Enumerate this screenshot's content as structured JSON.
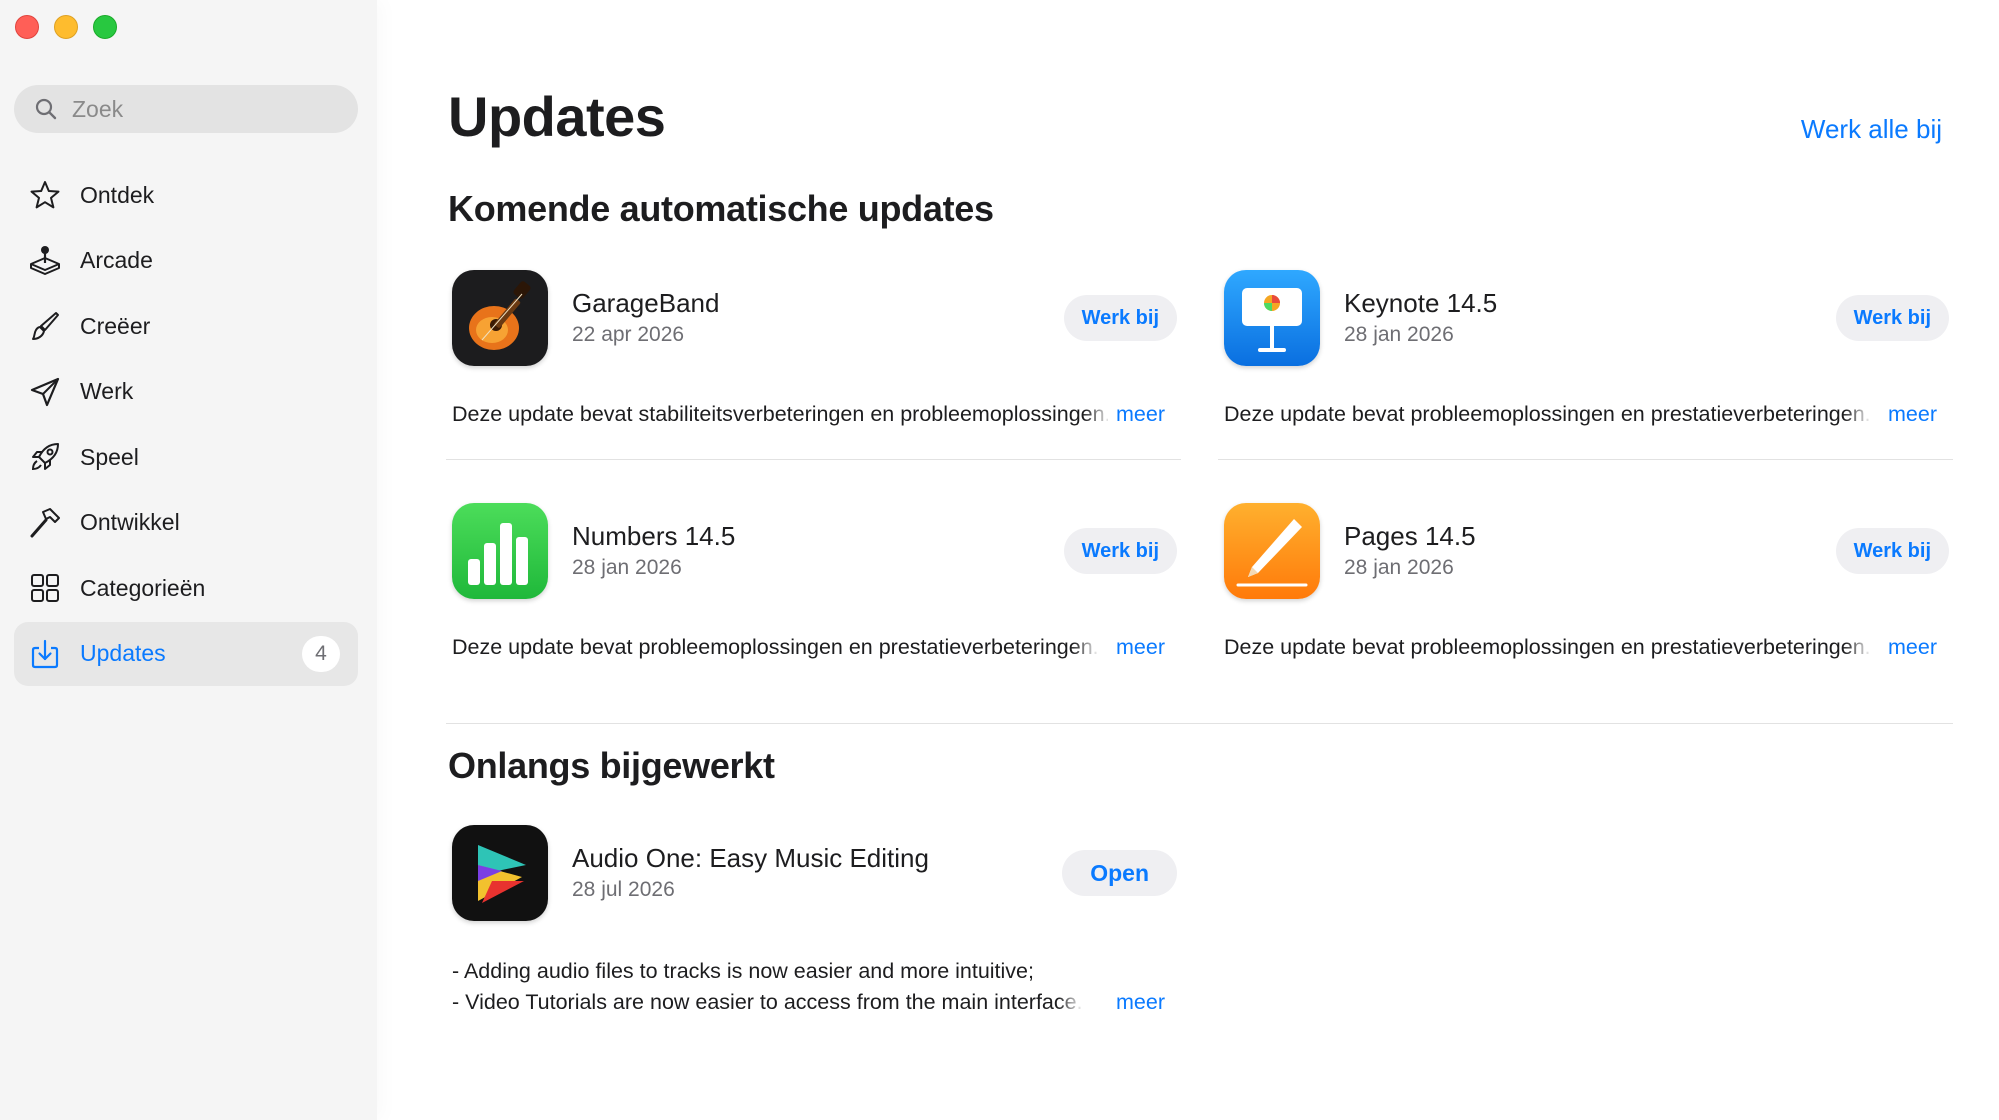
{
  "sidebar": {
    "search_placeholder": "Zoek",
    "items": [
      {
        "label": "Ontdek",
        "icon": "star-icon"
      },
      {
        "label": "Arcade",
        "icon": "joystick-icon"
      },
      {
        "label": "Creëer",
        "icon": "paintbrush-icon"
      },
      {
        "label": "Werk",
        "icon": "paperplane-icon"
      },
      {
        "label": "Speel",
        "icon": "rocket-icon"
      },
      {
        "label": "Ontwikkel",
        "icon": "hammer-icon"
      },
      {
        "label": "Categorieën",
        "icon": "grid-icon"
      },
      {
        "label": "Updates",
        "icon": "download-tray-icon",
        "badge": "4",
        "active": true
      }
    ]
  },
  "main": {
    "title": "Updates",
    "update_all_label": "Werk alle bij",
    "upcoming_title": "Komende automatische updates",
    "recent_title": "Onlangs bijgewerkt",
    "more_label": "meer",
    "update_button_label": "Werk bij",
    "open_button_label": "Open",
    "upcoming": [
      {
        "name": "GarageBand",
        "date": "22 apr 2026",
        "description": "Deze update bevat stabiliteitsverbeteringen en probleemoplossingen.",
        "icon": "garageband-icon"
      },
      {
        "name": "Keynote 14.5",
        "date": "28 jan 2026",
        "description": "Deze update bevat probleemoplossingen en prestatieverbeteringen.",
        "icon": "keynote-icon"
      },
      {
        "name": "Numbers 14.5",
        "date": "28 jan 2026",
        "description": "Deze update bevat probleemoplossingen en prestatieverbeteringen.",
        "icon": "numbers-icon"
      },
      {
        "name": "Pages 14.5",
        "date": "28 jan 2026",
        "description": "Deze update bevat probleemoplossingen en prestatieverbeteringen.",
        "icon": "pages-icon"
      }
    ],
    "recent": [
      {
        "name": "Audio One: Easy Music Editing",
        "date": "28 jul 2026",
        "description_line1": "- Adding audio files to tracks is now easier and more intuitive;",
        "description_line2": "- Video Tutorials are now easier to access from the main interface.",
        "icon": "audio-one-icon"
      }
    ]
  },
  "colors": {
    "accent": "#0a7aff",
    "sidebar_bg": "#f5f5f5",
    "close": "#ff5f57",
    "minimize": "#febc2e",
    "maximize": "#28c840"
  }
}
